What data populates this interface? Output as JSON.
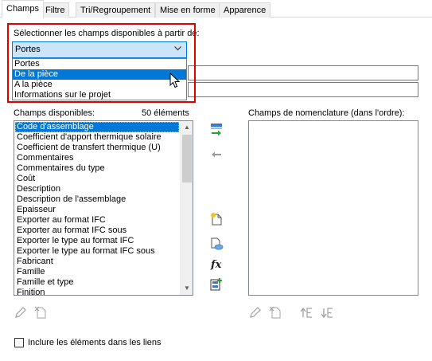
{
  "tabs": [
    "Champs",
    "Filtre",
    "Tri/Regroupement",
    "Mise en forme",
    "Apparence"
  ],
  "source": {
    "label": "Sélectionner les champs disponibles à partir de:",
    "selected": "Portes",
    "options": [
      "Portes",
      "De la pièce",
      "A la pièce",
      "Informations sur le projet"
    ],
    "highlighted_index": 1
  },
  "available": {
    "label": "Champs disponibles:",
    "count": "50 éléments",
    "items": [
      "Code d'assemblage",
      "Coefficient d'apport thermique solaire",
      "Coefficient de transfert thermique (U)",
      "Commentaires",
      "Commentaires du type",
      "Coût",
      "Description",
      "Description de l'assemblage",
      "Epaisseur",
      "Exporter au format IFC",
      "Exporter au format IFC sous",
      "Exporter le type au format IFC",
      "Exporter le type au format IFC sous",
      "Fabricant",
      "Famille",
      "Famille et type",
      "Finition"
    ],
    "selected_index": 0
  },
  "schedule": {
    "label": "Champs de nomenclature (dans l'ordre):"
  },
  "include_links": {
    "label": "Inclure les éléments dans les liens",
    "checked": false
  },
  "colors": {
    "accent": "#0078d7",
    "highlight_box": "#e00000"
  }
}
